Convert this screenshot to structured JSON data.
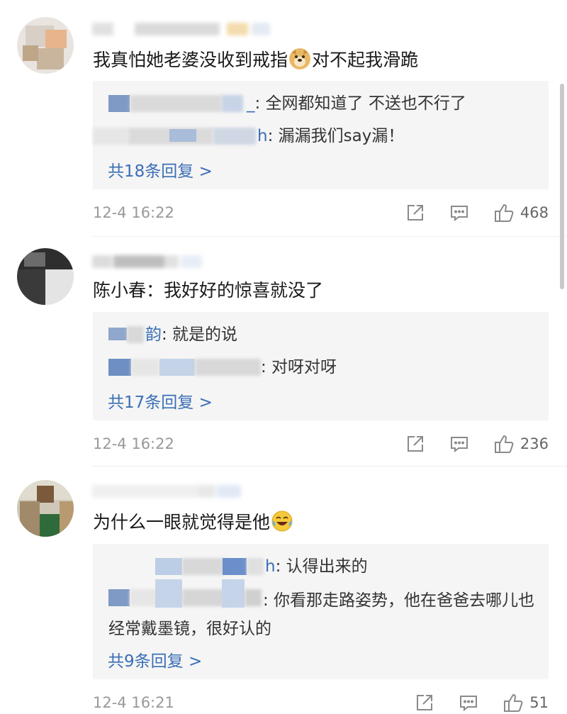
{
  "comments": [
    {
      "content": "我真怕她老婆没收到戒指",
      "content_tail": "对不起我滑跪",
      "replies": [
        {
          "name_tail": "_",
          "text": ": 全网都知道了 不送也不行了"
        },
        {
          "name_tail": "h",
          "text": ": 漏漏我们say漏！"
        }
      ],
      "more": "共18条回复 >",
      "time": "12-4 16:22",
      "likes": "468"
    },
    {
      "content": "陈小春：我好好的惊喜就没了",
      "replies": [
        {
          "name_tail": "韵",
          "text": ": 就是的说"
        },
        {
          "name_tail": "",
          "text": ": 对呀对呀"
        }
      ],
      "more": "共17条回复 >",
      "time": "12-4 16:22",
      "likes": "236"
    },
    {
      "content": "为什么一眼就觉得是他",
      "replies": [
        {
          "name_tail": "h",
          "text": ": 认得出来的"
        },
        {
          "name_tail": "",
          "text": ": 你看那走路姿势，他在爸爸去哪儿也经常戴墨镜，很好认的"
        }
      ],
      "more": "共9条回复 >",
      "time": "12-4 16:21",
      "likes": "51"
    }
  ],
  "icons": {
    "share": "share-icon",
    "comment": "comment-icon",
    "like": "thumbs-up-icon",
    "doge": "doge-emoji-icon",
    "laugh_cry": "laugh-cry-emoji-icon"
  },
  "colors": {
    "link_blue": "#3b6fb5",
    "reply_bg": "#f5f5f5",
    "meta_gray": "#999999"
  }
}
